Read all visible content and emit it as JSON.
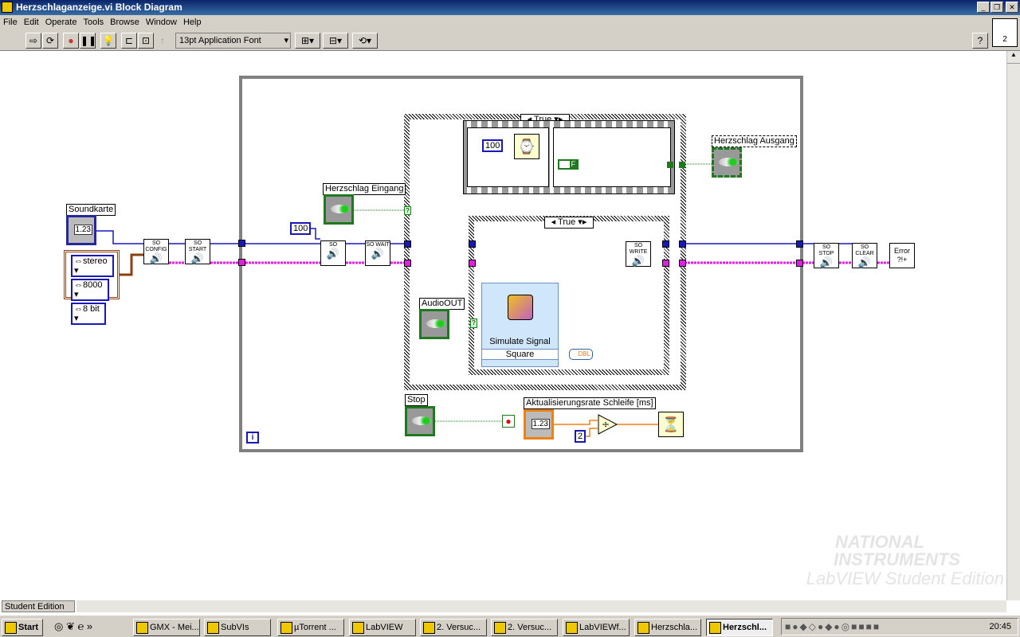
{
  "window": {
    "title": "Herzschlaganzeige.vi Block Diagram",
    "controls": [
      "minimize",
      "restore",
      "close"
    ]
  },
  "menu": [
    "File",
    "Edit",
    "Operate",
    "Tools",
    "Browse",
    "Window",
    "Help"
  ],
  "toolbar": {
    "buttons": [
      "run-arrow-icon",
      "run-continuously-icon",
      "abort-icon",
      "pause-icon",
      "highlight-execution-icon",
      "retain-wire-values-icon",
      "step-into-icon"
    ],
    "font": "13pt Application Font",
    "help": "?",
    "vi_icon_text": "2"
  },
  "diagram": {
    "soundkarte": {
      "label": "Soundkarte",
      "value": "1.23",
      "type": "I8"
    },
    "enum_cluster": [
      "stereo",
      "8000",
      "8 bit"
    ],
    "vis": {
      "config": "SO CONFIG",
      "start": "SO START",
      "timeout": "SO",
      "wait": "SO WAIT",
      "write": "SO WRITE",
      "stop": "SO STOP",
      "clear": "SO CLEAR",
      "error": "Error ?!+"
    },
    "timeout_const": "100",
    "herzschlag_eingang": {
      "label": "Herzschlag Eingang",
      "type": "TF"
    },
    "outer_case": "True",
    "inner_case": "True",
    "sequence_wait_const": "100",
    "false_const": "F",
    "herzschlag_ausgang": {
      "label": "Herzschlag Ausgang",
      "type": "TF"
    },
    "audio_out": {
      "label": "AudioOUT",
      "type": "TF"
    },
    "simulate_signal": {
      "title": "Simulate Signal",
      "mode": "Square"
    },
    "convert": "DBL",
    "stop": {
      "label": "Stop",
      "type": "TF"
    },
    "rate": {
      "label": "Aktualisierungsrate Schleife [ms]",
      "value": "1.23",
      "type": "DBL"
    },
    "divisor_const": "2",
    "iteration": "i",
    "unknown_tunnel": "?"
  },
  "status": {
    "edition": "Student Edition"
  },
  "watermark": {
    "line1": "NATIONAL",
    "line2": "INSTRUMENTS",
    "line3": "LabVIEW Student Edition"
  },
  "taskbar": {
    "start": "Start",
    "tasks": [
      "GMX - Mei...",
      "SubVIs",
      "µTorrent ...",
      "LabVIEW",
      "2. Versuc...",
      "2. Versuc...",
      "LabVIEWf...",
      "Herzschla...",
      "Herzschl..."
    ],
    "clock": "20:45"
  },
  "colors": {
    "int_wire": "#1818b8",
    "error_wire": "#e020e0",
    "bool_wire": "#1f7a1f",
    "dbl_wire": "#f08010"
  }
}
